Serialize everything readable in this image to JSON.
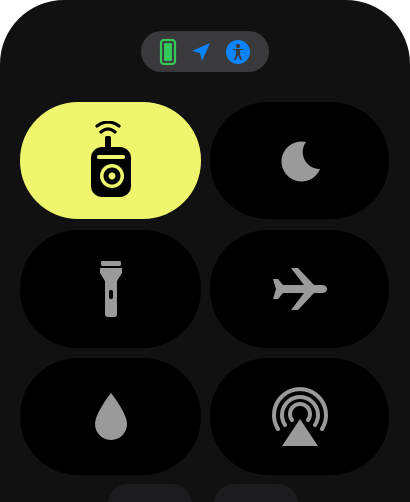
{
  "status": {
    "icons": [
      "battery-icon",
      "location-arrow-icon",
      "accessibility-icon"
    ],
    "colors": {
      "battery": "#34c759",
      "location": "#0a84ff",
      "accessibility": "#0a84ff",
      "pill": "#3a3a3c"
    }
  },
  "tiles": [
    {
      "id": "walkie-talkie",
      "icon": "walkie-talkie-icon",
      "active": true
    },
    {
      "id": "do-not-disturb",
      "icon": "moon-icon",
      "active": false
    },
    {
      "id": "flashlight",
      "icon": "flashlight-icon",
      "active": false
    },
    {
      "id": "airplane-mode",
      "icon": "airplane-icon",
      "active": false
    },
    {
      "id": "water-lock",
      "icon": "water-drop-icon",
      "active": false
    },
    {
      "id": "airplay",
      "icon": "airplay-icon",
      "active": false
    }
  ],
  "colors": {
    "active_tile": "#f0f56e",
    "tile": "#000000",
    "icon_inactive": "#9a9a9a",
    "background": "#111111"
  }
}
